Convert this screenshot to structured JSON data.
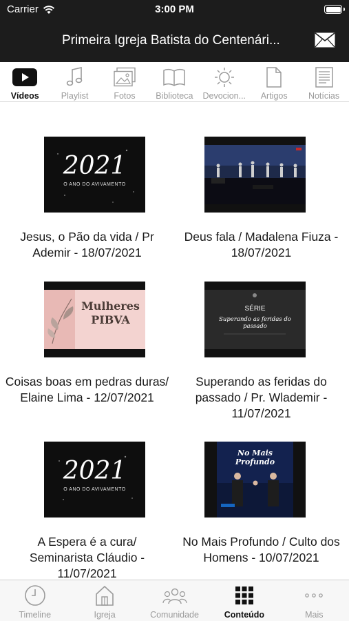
{
  "status_bar": {
    "carrier": "Carrier",
    "time": "3:00 PM"
  },
  "header": {
    "title": "Primeira Igreja Batista do Centenári...",
    "mail_icon": "envelope-icon"
  },
  "tabs": [
    {
      "label": "Vídeos",
      "icon": "video-play-icon",
      "active": true
    },
    {
      "label": "Playlist",
      "icon": "music-note-icon",
      "active": false
    },
    {
      "label": "Fotos",
      "icon": "photos-icon",
      "active": false
    },
    {
      "label": "Biblioteca",
      "icon": "book-icon",
      "active": false
    },
    {
      "label": "Devocion...",
      "icon": "sun-icon",
      "active": false
    },
    {
      "label": "Artigos",
      "icon": "document-icon",
      "active": false
    },
    {
      "label": "Notícias",
      "icon": "newspaper-icon",
      "active": false
    }
  ],
  "videos": [
    {
      "caption": "Jesus, o Pão da vida / Pr Ademir - 18/07/2021",
      "thumb_text": "2021",
      "thumb_sub": "O ANO DO AVIVAMENTO"
    },
    {
      "caption": "Deus fala / Madalena Fiuza - 18/07/2021",
      "thumb_text": "",
      "thumb_sub": ""
    },
    {
      "caption": "Coisas boas em pedras duras/ Elaine Lima - 12/07/2021",
      "thumb_text": "Mulheres PIBVA",
      "thumb_sub": ""
    },
    {
      "caption": "Superando as feridas do passado / Pr. Wlademir - 11/07/2021",
      "thumb_text": "SÉRIE",
      "thumb_sub": "Superando as feridas do passado"
    },
    {
      "caption": "A Espera é a cura/ Seminarista Cláudio - 11/07/2021",
      "thumb_text": "2021",
      "thumb_sub": "O ANO DO AVIVAMENTO"
    },
    {
      "caption": "No Mais Profundo / Culto dos Homens - 10/07/2021",
      "thumb_text": "No Mais Profundo",
      "thumb_sub": ""
    }
  ],
  "bottom_tabs": [
    {
      "label": "Timeline",
      "icon": "clock-icon",
      "active": false
    },
    {
      "label": "Igreja",
      "icon": "church-icon",
      "active": false
    },
    {
      "label": "Comunidade",
      "icon": "community-icon",
      "active": false
    },
    {
      "label": "Conteúdo",
      "icon": "grid-icon",
      "active": true
    },
    {
      "label": "Mais",
      "icon": "more-dots-icon",
      "active": false
    }
  ]
}
